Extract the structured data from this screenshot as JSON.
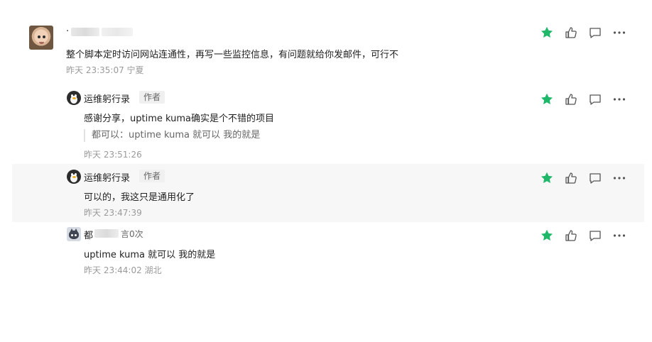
{
  "colors": {
    "star": "#1fb86b",
    "icon": "#555555",
    "meta": "#9a9a9a",
    "hover_bg": "#f7f7f7"
  },
  "comments": [
    {
      "author_visible": "·",
      "author_suffix": "",
      "author_blurred": true,
      "text": "整个脚本定时访问网站连通性，再写一些监控信息，有问题就给你发邮件，可行不",
      "time": "昨天 23:35:07 宁夏"
    },
    {
      "author": "运维躬行录",
      "tag": "作者",
      "text": "感谢分享，uptime kuma确实是个不错的项目",
      "quote": "都可以：uptime kuma 就可以 我的就是",
      "time": "昨天 23:51:26"
    },
    {
      "author": "运维躬行录",
      "tag": "作者",
      "text": "可以的，我这只是通用化了",
      "time": "昨天 23:47:39"
    },
    {
      "author_visible": "都",
      "author_suffix": "言0次",
      "author_blurred": true,
      "text": "uptime kuma 就可以 我的就是",
      "time": "昨天 23:44:02 湖北"
    }
  ],
  "icons": [
    "star-icon",
    "thumbs-up-icon",
    "comment-icon",
    "more-icon"
  ]
}
